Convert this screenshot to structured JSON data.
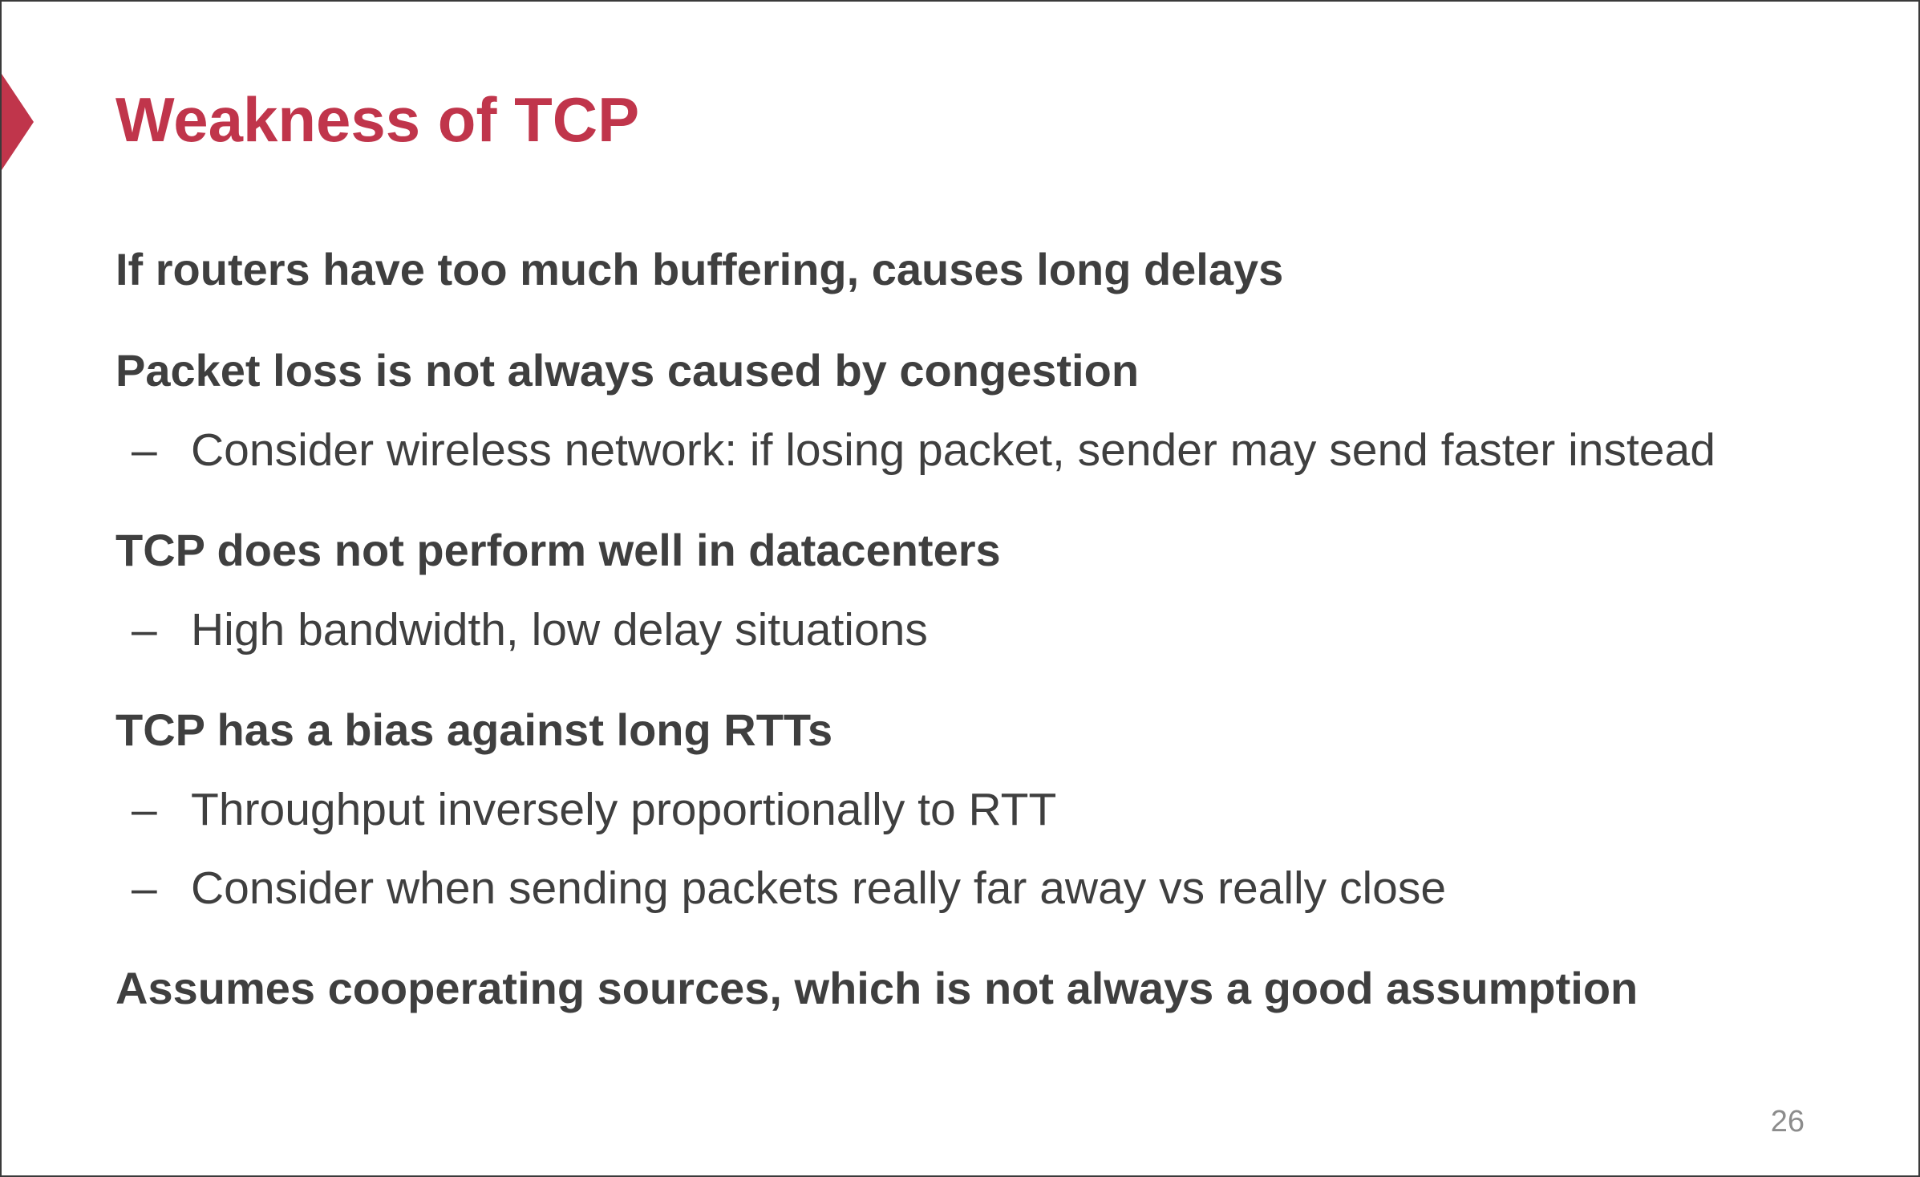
{
  "slide": {
    "title": "Weakness of TCP",
    "accent_color": "#c0354b",
    "text_color": "#3f3f3f",
    "bullets": [
      {
        "text": "If routers have too much buffering, causes long delays",
        "subitems": []
      },
      {
        "text": "Packet loss is not always caused by congestion",
        "subitems": [
          {
            "dash": "–",
            "text": "Consider wireless network: if losing packet, sender may send faster instead"
          }
        ]
      },
      {
        "text": "TCP does not perform well in datacenters",
        "subitems": [
          {
            "dash": "–",
            "text": "High bandwidth, low delay situations"
          }
        ]
      },
      {
        "text": "TCP has a bias against long RTTs",
        "subitems": [
          {
            "dash": "–",
            "text": "Throughput inversely proportionally to RTT"
          },
          {
            "dash": "–",
            "text": "Consider when sending packets really far away vs really close"
          }
        ]
      },
      {
        "text": "Assumes cooperating sources, which is not always a good assumption",
        "subitems": []
      }
    ],
    "page_number": "26"
  }
}
